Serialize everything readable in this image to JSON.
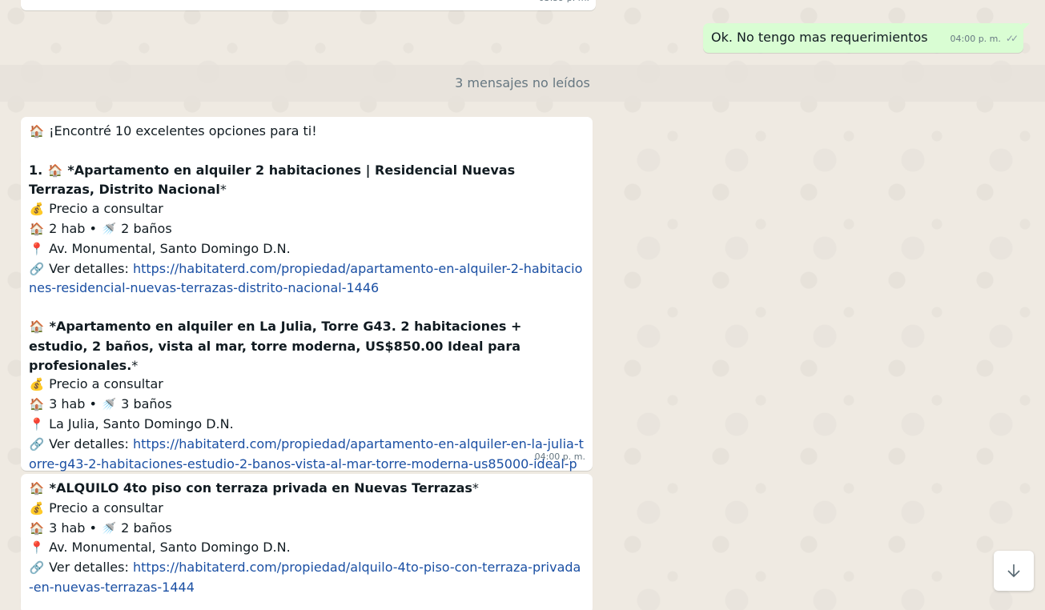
{
  "previous_incoming": {
    "time": "03:59 p. m."
  },
  "outgoing": {
    "text": "Ok. No tengo mas requerimientos",
    "time": "04:00 p. m.",
    "status": "read-ticks-icon"
  },
  "unread_divider": "3 mensajes no leídos",
  "message1": {
    "intro": "¡Encontré 10 excelentes opciones para ti!",
    "time": "04:00 p. m.",
    "listings": [
      {
        "prefix": "1. ",
        "title": "*Apartamento en alquiler 2 habitaciones | Residencial Nuevas Terrazas, Distrito Nacional",
        "title_suffix": "*",
        "price": "Precio a consultar",
        "hab": "2 hab • ",
        "banos": "2 baños",
        "location": "Av. Monumental, Santo Domingo D.N.",
        "details_label": "Ver detalles: ",
        "url": "https://habitaterd.com/propiedad/apartamento-en-alquiler-2-habitaciones-residencial-nuevas-terrazas-distrito-nacional-1446"
      },
      {
        "prefix": "",
        "title": "*Apartamento en alquiler en La Julia, Torre G43. 2 habitaciones + estudio, 2 baños, vista al mar, torre moderna, US$850.00 Ideal para profesionales.",
        "title_suffix": "*",
        "price": "Precio a consultar",
        "hab": "3 hab • ",
        "banos": "3 baños",
        "location": "La Julia, Santo Domingo D.N.",
        "details_label": "Ver detalles: ",
        "url": "https://habitaterd.com/propiedad/apartamento-en-alquiler-en-la-julia-torre-g43-2-habitaciones-estudio-2-banos-vista-al-mar-torre-moderna-us85000-ideal-para-profesionales-1445"
      }
    ]
  },
  "message2": {
    "listing": {
      "title": "*ALQUILO 4to piso con terraza privada en Nuevas Terrazas",
      "title_suffix": "*",
      "price": "Precio a consultar",
      "hab": "3 hab • ",
      "banos": "2 baños",
      "location": "Av. Monumental, Santo Domingo D.N.",
      "details_label": "Ver detalles: ",
      "url": "https://habitaterd.com/propiedad/alquilo-4to-piso-con-terraza-privada-en-nuevas-terrazas-1444"
    }
  },
  "icons": {
    "house": "🏠",
    "money": "💰",
    "shower": "🚿",
    "pin": "📍",
    "link": "🔗",
    "smile": "😊",
    "scroll_down": "↓"
  },
  "colors": {
    "background": "#efeae2",
    "outgoing_bubble": "#d9fdd3",
    "incoming_bubble": "#ffffff",
    "link": "#1a4fa3",
    "meta_text": "#667781"
  }
}
